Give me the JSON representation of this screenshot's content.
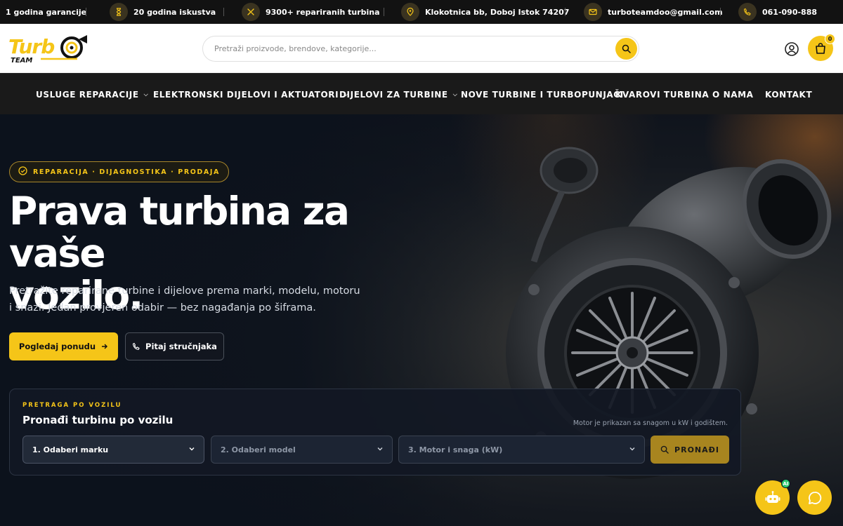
{
  "topbar": {
    "items": [
      {
        "icon": "award-icon",
        "text": "1 godina garancije"
      },
      {
        "icon": "hourglass-icon",
        "text": "20 godina iskustva"
      },
      {
        "icon": "tools-icon",
        "text": "9300+ repariranih turbina"
      },
      {
        "icon": "location-pin-icon",
        "text": "Klokotnica bb, Doboj Istok 74207"
      },
      {
        "icon": "mail-icon",
        "text": "turboteamdoo@gmail.com"
      },
      {
        "icon": "phone-icon",
        "text": "061-090-888"
      }
    ]
  },
  "header": {
    "logo": {
      "word": "Turbo",
      "sub": "TEAM"
    },
    "search_placeholder": "Pretraži proizvode, brendove, kategorije...",
    "cart_count": "0"
  },
  "nav": {
    "items": [
      {
        "label": "USLUGE REPARACIJE",
        "dropdown": true
      },
      {
        "label": "ELEKTRONSKI DIJELOVI I AKTUATORI",
        "dropdown": true
      },
      {
        "label": "DIJELOVI ZA TURBINE",
        "dropdown": true
      },
      {
        "label": "NOVE TURBINE I TURBOPUNJAČI",
        "dropdown": false
      },
      {
        "label": "KVAROVI TURBINA",
        "dropdown": false
      },
      {
        "label": "O NAMA",
        "dropdown": false
      },
      {
        "label": "KONTAKT",
        "dropdown": false
      }
    ]
  },
  "hero": {
    "badge": "REPARACIJA · DIJAGNOSTIKA · PRODAJA",
    "title_line1": "Prava turbina za vaše",
    "title_line2": "vozilo.",
    "lead": "Pretražite reparirane turbine i dijelove prema marki, modelu, motoru i snazi. Jedan provjeren odabir — bez nagađanja po šiframa.",
    "primary_button": "Pogledaj ponudu",
    "secondary_button": "Pitaj stručnjaka"
  },
  "finder": {
    "kicker": "PRETRAGA PO VOZILU",
    "title": "Pronađi turbinu po vozilu",
    "note": "Motor je prikazan sa snagom u kW i godištem.",
    "select_brand": "1. Odaberi marku",
    "select_model": "2. Odaberi model",
    "select_engine": "3. Motor i snaga (kW)",
    "find_button": "PRONAĐI"
  },
  "floating": {
    "bot_badge": "AI"
  },
  "colors": {
    "accent": "#f5c518",
    "topbar_bg": "#121212",
    "nav_bg": "#1a1a1a",
    "hero_bg": "#0d1320"
  }
}
